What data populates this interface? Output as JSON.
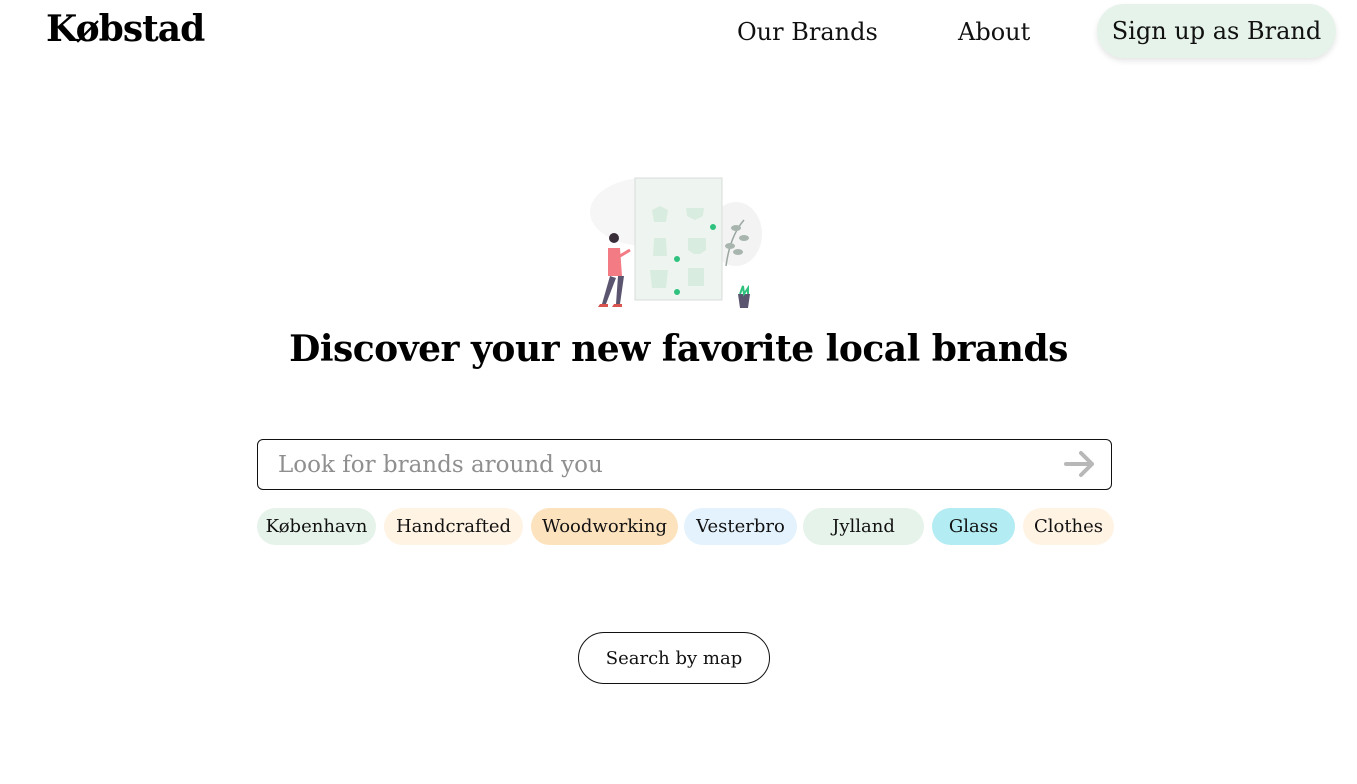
{
  "header": {
    "logo": "Købstad",
    "nav": {
      "our_brands": "Our Brands",
      "about": "About"
    },
    "signup_label": "Sign up as Brand"
  },
  "hero": {
    "illustration_icon": "shopping-woman-illustration",
    "headline": "Discover your new favorite local brands"
  },
  "search": {
    "placeholder": "Look for brands around you",
    "value": "",
    "submit_icon": "arrow-right-icon"
  },
  "tags": [
    {
      "label": "København",
      "color": "#e6f3ea"
    },
    {
      "label": "Handcrafted",
      "color": "#fff3e3"
    },
    {
      "label": "Woodworking",
      "color": "#fde2be"
    },
    {
      "label": "Vesterbro",
      "color": "#e3f2fc"
    },
    {
      "label": "Jylland",
      "color": "#e6f3ea"
    },
    {
      "label": "Glass",
      "color": "#b3ecf2"
    },
    {
      "label": "Clothes",
      "color": "#fff3e3"
    }
  ],
  "map_button_label": "Search by map",
  "colors": {
    "accent_green": "#e6f3ea",
    "border": "#111111",
    "placeholder": "#8f8f8f"
  }
}
